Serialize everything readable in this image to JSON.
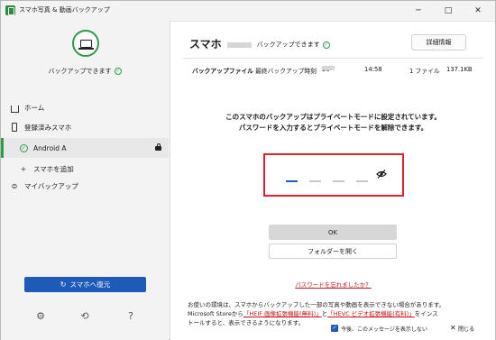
{
  "window": {
    "title": "スマホ写真 & 動画バックアップ",
    "minimize": "─",
    "maximize": "□",
    "close": "✕"
  },
  "sidebar": {
    "status_label": "バックアップできます",
    "nav": {
      "home": "ホーム",
      "registered": "登録済みスマホ",
      "android": "Android A",
      "add_phone": "スマホを追加",
      "my_backup": "マイバックアップ"
    },
    "restore_button": "スマホへ復元",
    "restore_icon": "↻"
  },
  "main": {
    "title": "スマホ",
    "title_status": "バックアップできます",
    "details_button": "詳細情報",
    "info": {
      "label": "バックアップファイル",
      "last_backup_label": "最終バックアップ時刻",
      "date_prefix": "20",
      "time": "14:58",
      "files": "1 ファイル",
      "size": "137.1KB"
    },
    "message_line1": "このスマホのバックアップはプライベートモードに設定されています。",
    "message_line2": "パスワードを入力するとプライベートモードを解除できます。",
    "ok_button": "OK",
    "open_folder_button": "フォルダーを開く",
    "forgot_link": "パスワードを忘れましたか？",
    "notice_line1": "お使いの環境は、スマホからバックアップした一部の写真や動画を表示できない場合があります。",
    "notice_line2_pre": "Microsoft Storeから",
    "notice_link1": "「HEIF 画像拡張機能(無料)」",
    "notice_mid": "と",
    "notice_link2": "「HEVC ビデオ拡張機能(有料)」",
    "notice_line2_post": "をインス",
    "notice_line3": "トールすると、表示できるようになります。",
    "dont_show_label": "今後、このメッセージを表示しない",
    "close_label": "閉じる"
  },
  "colors": {
    "accent_green": "#2e9b46",
    "primary_blue": "#1e5bb8",
    "highlight_red": "#e0202a",
    "link_red": "#c4161c"
  }
}
